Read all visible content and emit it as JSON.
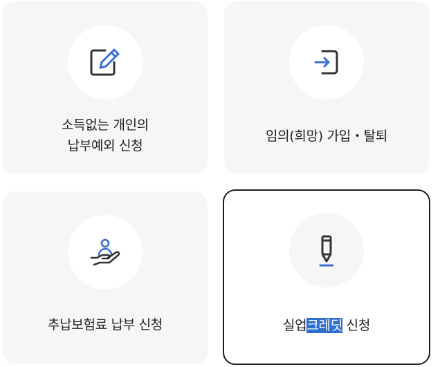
{
  "cards": [
    {
      "lines": [
        "소득없는 개인의",
        "납부예외 신청"
      ],
      "icon": "edit-icon"
    },
    {
      "lines": [
        "임의(희망) 가입・탈퇴"
      ],
      "icon": "sign-in-icon"
    },
    {
      "lines": [
        "추납보험료 납부 신청"
      ],
      "icon": "hand-person-icon"
    },
    {
      "parts": [
        "실업",
        "크레딧",
        " 신청"
      ],
      "icon": "pencil-icon",
      "selected": true,
      "highlighted_text": "크레딧"
    }
  ],
  "colors": {
    "card_bg": "#f6f6f7",
    "icon_dark": "#333333",
    "icon_accent": "#3a6fd0",
    "selected_border": "#1d1d1d",
    "selection_highlight": "#2f6fcf"
  }
}
